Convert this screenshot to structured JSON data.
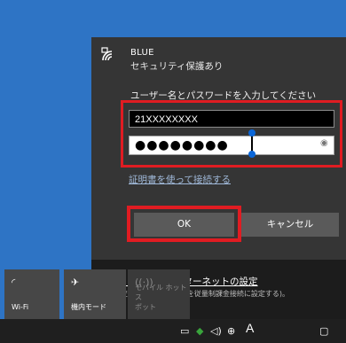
{
  "network": {
    "ssid": "BLUE",
    "security_status": "セキュリティ保護あり",
    "prompt": "ユーザー名とパスワードを入力してください",
    "username_value": "21XXXXXXXX",
    "password_mask": "●●●●●●●●",
    "cert_link": "証明書を使って接続する",
    "ok_label": "OK",
    "cancel_label": "キャンセル"
  },
  "settings": {
    "link": "ネットワークとインターネットの設定",
    "description": "設定を変更します (例: 接続を従量制課金接続に設定する)。"
  },
  "tiles": [
    {
      "icon": "wifi-icon",
      "label": "Wi-Fi",
      "active": true
    },
    {
      "icon": "airplane-icon",
      "label": "機内モード",
      "active": true
    },
    {
      "icon": "mobile-hotspot-icon",
      "label": "モバイル ホットス\nポット",
      "active": false
    }
  ],
  "taskbar": {
    "ime_label": "A"
  },
  "colors": {
    "desktop": "#2e74c5",
    "panel": "#1c1c1c",
    "highlight_frame": "#e01c22"
  }
}
